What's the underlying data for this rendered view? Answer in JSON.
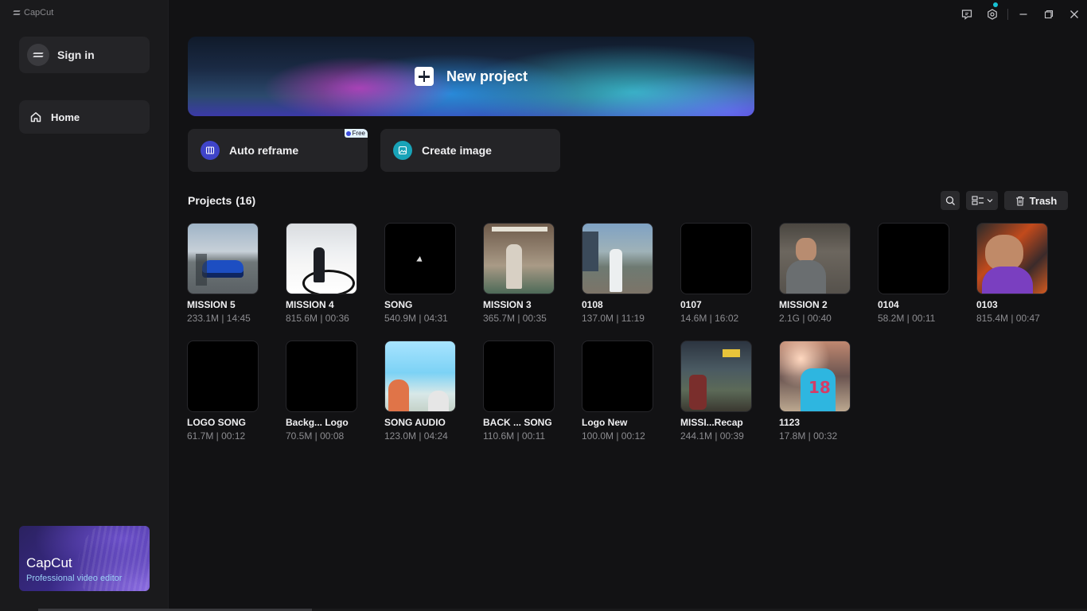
{
  "app": {
    "name": "CapCut"
  },
  "sidebar": {
    "signin_label": "Sign in",
    "home_label": "Home",
    "promo_title": "CapCut",
    "promo_subtitle": "Professional video editor"
  },
  "banner": {
    "new_project_label": "New project"
  },
  "tiles": {
    "auto_reframe_label": "Auto reframe",
    "auto_reframe_badge": "Free",
    "create_image_label": "Create image"
  },
  "projects": {
    "title": "Projects",
    "count": "(16)",
    "trash_label": "Trash",
    "items": [
      {
        "name": "MISSION 5",
        "meta": "233.1M | 14:45",
        "thumb": "t-car"
      },
      {
        "name": "MISSION 4",
        "meta": "815.6M | 00:36",
        "thumb": "t-room"
      },
      {
        "name": "SONG",
        "meta": "540.9M | 04:31",
        "thumb": "t-black t-cursor"
      },
      {
        "name": "MISSION 3",
        "meta": "365.7M | 00:35",
        "thumb": "t-bath"
      },
      {
        "name": "0108",
        "meta": "137.0M | 11:19",
        "thumb": "t-street"
      },
      {
        "name": "0107",
        "meta": "14.6M | 16:02",
        "thumb": "t-black"
      },
      {
        "name": "MISSION 2",
        "meta": "2.1G | 00:40",
        "thumb": "t-man"
      },
      {
        "name": "0104",
        "meta": "58.2M | 00:11",
        "thumb": "t-black"
      },
      {
        "name": "0103",
        "meta": "815.4M | 00:47",
        "thumb": "t-stream"
      },
      {
        "name": "LOGO SONG",
        "meta": "61.7M | 00:12",
        "thumb": "t-black"
      },
      {
        "name": "Backg... Logo",
        "meta": "70.5M | 00:08",
        "thumb": "t-black"
      },
      {
        "name": "SONG AUDIO",
        "meta": "123.0M | 04:24",
        "thumb": "t-sky"
      },
      {
        "name": "BACK ... SONG",
        "meta": "110.6M | 00:11",
        "thumb": "t-black"
      },
      {
        "name": "Logo New",
        "meta": "100.0M | 00:12",
        "thumb": "t-black"
      },
      {
        "name": "MISSI...Recap",
        "meta": "244.1M | 00:39",
        "thumb": "t-subway"
      },
      {
        "name": "1123",
        "meta": "17.8M | 00:32",
        "thumb": "t-jersey"
      }
    ]
  },
  "colors": {
    "background": "#121214",
    "sidebar": "#1a1a1c",
    "accent": "#17c2d4",
    "tile": "#242427"
  },
  "icons": {
    "titlebar": [
      "feedback-icon",
      "settings-icon",
      "minimize-icon",
      "restore-icon",
      "close-icon"
    ],
    "tools": [
      "search-icon",
      "view-toggle-icon",
      "trash-icon"
    ]
  }
}
